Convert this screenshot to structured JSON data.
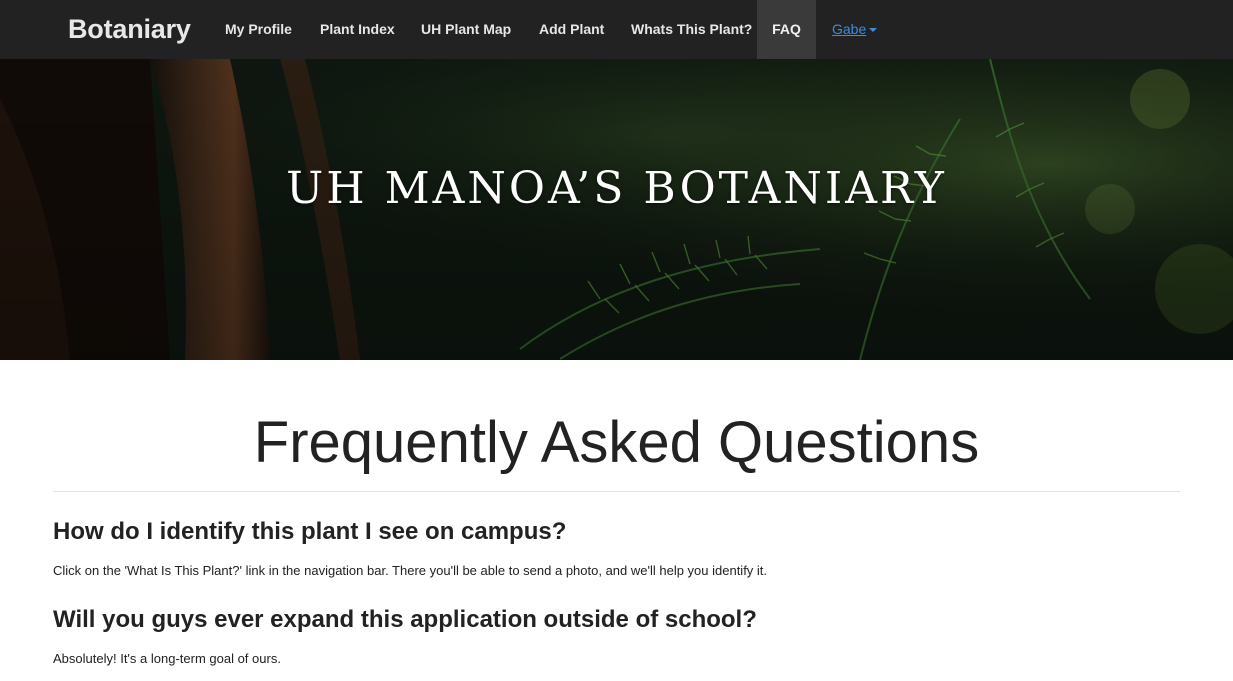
{
  "navbar": {
    "brand": "Botaniary",
    "items": [
      {
        "label": "My Profile"
      },
      {
        "label": "Plant Index"
      },
      {
        "label": "UH Plant Map"
      },
      {
        "label": "Add Plant"
      },
      {
        "label": "Whats This Plant?"
      },
      {
        "label": "FAQ",
        "active": true
      }
    ],
    "user_menu": {
      "label": "Gabe"
    }
  },
  "hero": {
    "title": "UH MANOA’S BOTANIARY"
  },
  "main": {
    "title": "Frequently Asked Questions",
    "faqs": [
      {
        "question": "How do I identify this plant I see on campus?",
        "answer": "Click on the 'What Is This Plant?' link in the navigation bar. There you'll be able to send a photo, and we'll help you identify it."
      },
      {
        "question": "Will you guys ever expand this application outside of school?",
        "answer": "Absolutely! It's a long-term goal of ours."
      }
    ]
  },
  "colors": {
    "navbar_bg": "#222222",
    "active_item_bg": "#3a3a3a",
    "link_blue": "#3b8ddd",
    "text": "#222222"
  }
}
